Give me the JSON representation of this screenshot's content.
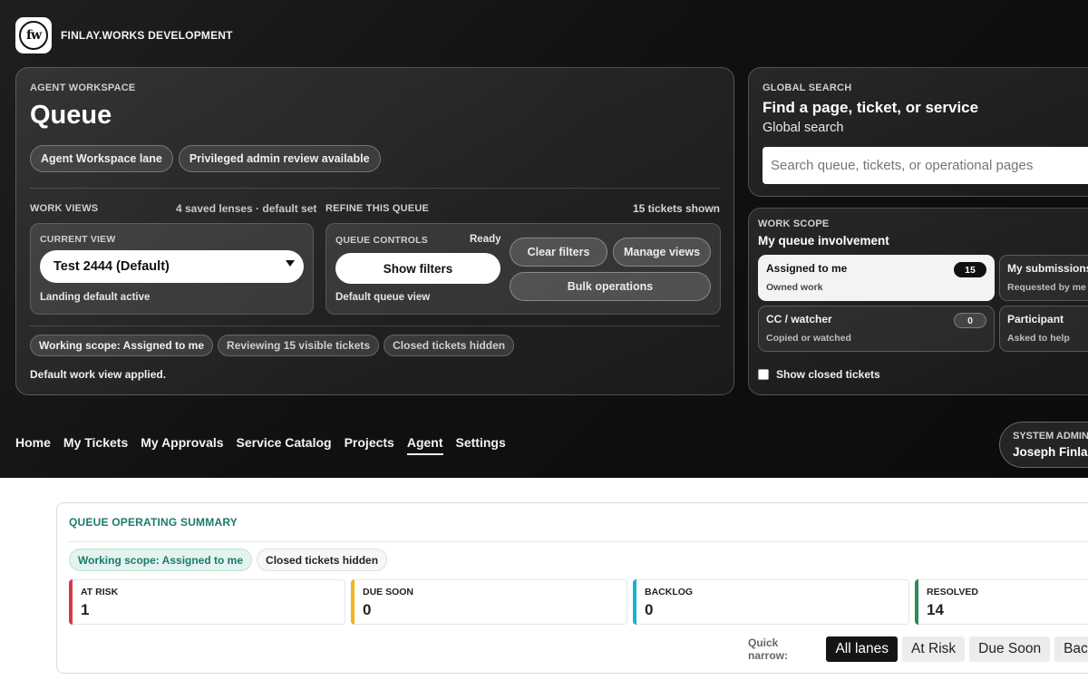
{
  "brand": {
    "name": "FINLAY.WORKS DEVELOPMENT",
    "logo_text": "fw"
  },
  "workspace": {
    "kicker": "AGENT WORKSPACE",
    "title": "Queue",
    "pills": [
      "Agent Workspace lane",
      "Privileged admin review available"
    ],
    "work_views": {
      "label": "WORK VIEWS",
      "meta": "4 saved lenses · default set",
      "current_view_label": "CURRENT VIEW",
      "current_view_value": "Test 2444 (Default)",
      "current_view_note": "Landing default active"
    },
    "refine": {
      "label": "REFINE THIS QUEUE",
      "meta": "15 tickets shown",
      "controls_label": "QUEUE CONTROLS",
      "controls_status": "Ready",
      "show_filters": "Show filters",
      "default_note": "Default queue view",
      "clear_filters": "Clear filters",
      "manage_views": "Manage views",
      "bulk_operations": "Bulk operations"
    },
    "chips": [
      "Working scope: Assigned to me",
      "Reviewing 15 visible tickets",
      "Closed tickets hidden"
    ],
    "status_note": "Default work view applied."
  },
  "global_search": {
    "kicker": "GLOBAL SEARCH",
    "title": "Find a page, ticket, or service",
    "subtitle": "Global search",
    "placeholder": "Search queue, tickets, or operational pages"
  },
  "work_scope": {
    "kicker": "WORK SCOPE",
    "title": "My queue involvement",
    "cards": [
      {
        "title": "Assigned to me",
        "sub": "Owned work",
        "count": "15",
        "active": true
      },
      {
        "title": "My submissions",
        "sub": "Requested by me",
        "count": "",
        "active": false
      },
      {
        "title": "CC / watcher",
        "sub": "Copied or watched",
        "count": "0",
        "active": false
      },
      {
        "title": "Participant",
        "sub": "Asked to help",
        "count": "",
        "active": false
      }
    ],
    "show_closed_label": "Show closed tickets",
    "show_closed_checked": false
  },
  "nav": {
    "items": [
      "Home",
      "My Tickets",
      "My Approvals",
      "Service Catalog",
      "Projects",
      "Agent",
      "Settings"
    ],
    "current": "Agent"
  },
  "user": {
    "role": "SYSTEM ADMIN",
    "name": "Joseph Finla"
  },
  "summary": {
    "title": "QUEUE OPERATING SUMMARY",
    "chips": [
      "Working scope: Assigned to me",
      "Closed tickets hidden"
    ],
    "stats": [
      {
        "label": "AT RISK",
        "value": "1",
        "color": "#d63a45"
      },
      {
        "label": "DUE SOON",
        "value": "0",
        "color": "#f0b41f"
      },
      {
        "label": "BACKLOG",
        "value": "0",
        "color": "#19b3d6"
      },
      {
        "label": "RESOLVED",
        "value": "14",
        "color": "#2e8b57"
      }
    ],
    "quick_narrow_label": "Quick narrow:",
    "lanes": [
      "All lanes",
      "At Risk",
      "Due Soon",
      "Backl"
    ],
    "selected_lane": "All lanes"
  }
}
